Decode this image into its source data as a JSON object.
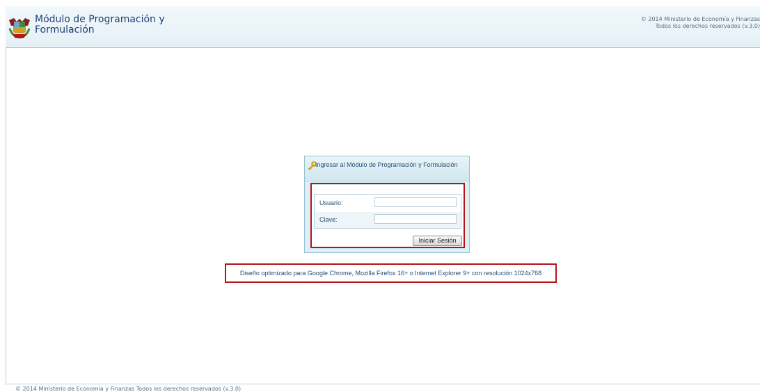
{
  "header": {
    "app_title_line1": "Módulo de Programación y",
    "app_title_line2": "Formulación",
    "copyright_line1": "© 2014 Ministerio de Economía y Finanzas",
    "copyright_line2": "Todos los derechos reservados (v.3.0)"
  },
  "login": {
    "title": "Ingresar al Módulo de Programación y Formulación",
    "icon": "key-icon",
    "username_label": "Usuario:",
    "username_value": "",
    "password_label": "Clave:",
    "password_value": "",
    "submit_label": "Iniciar Sesión"
  },
  "notice": {
    "text": "Diseño optimizado para Google Chrome, Mozilla Firefox 16+ o Internet Explorer 9+ con resolución 1024x768"
  },
  "footer": {
    "text": "© 2014 Ministerio de Economía y Finanzas Todos los derechos reservados (v.3.0)"
  },
  "colors": {
    "header_bg": "#e4f0f6",
    "title_text": "#1d3f75",
    "highlight_border": "#b3141a",
    "panel_border": "#97c2d3"
  }
}
